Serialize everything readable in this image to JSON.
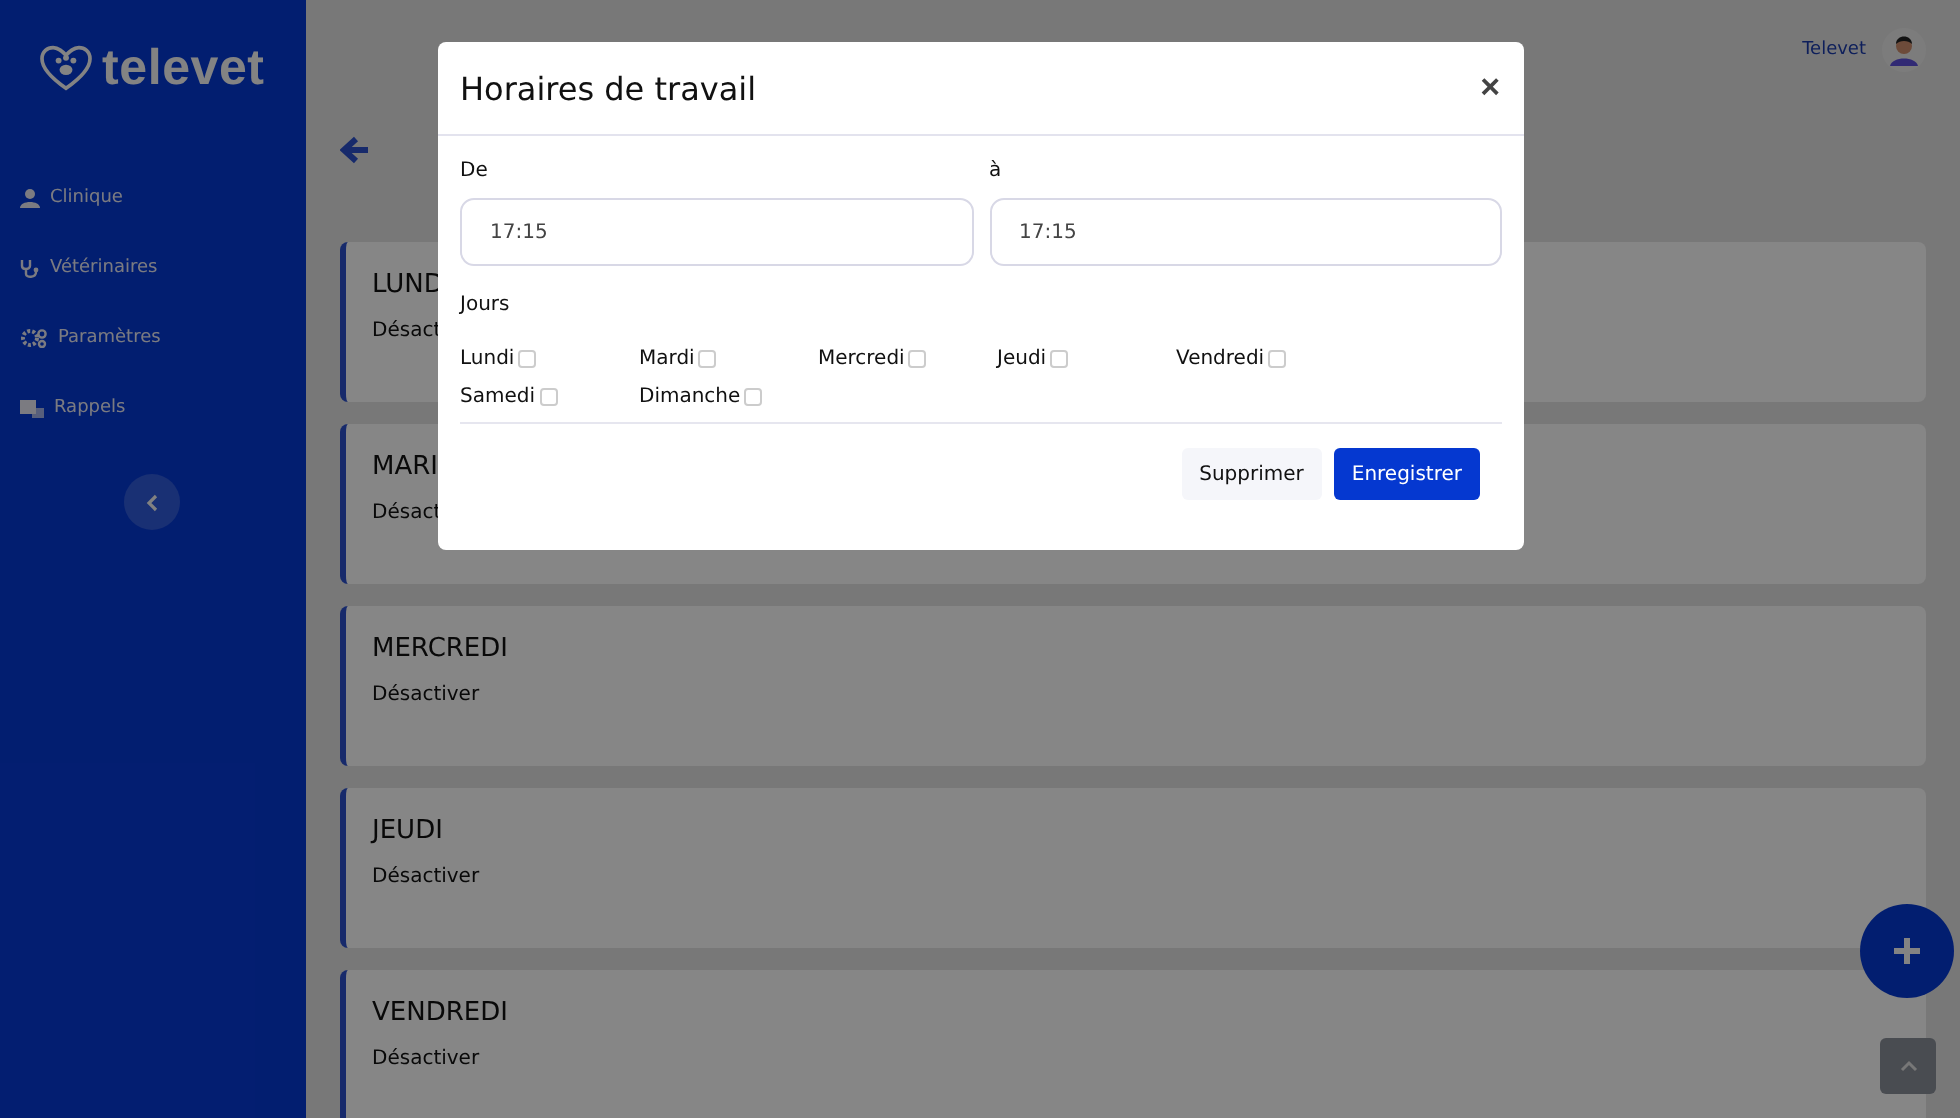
{
  "sidebar": {
    "logo": "televet",
    "items": [
      {
        "label": "Clinique",
        "kind": "person"
      },
      {
        "label": "Vétérinaires",
        "kind": "stethoscope"
      },
      {
        "label": "Paramètres",
        "kind": "gears"
      },
      {
        "label": "Rappels",
        "kind": "reminders"
      }
    ]
  },
  "header": {
    "user": "Televet"
  },
  "cards": [
    {
      "title": "LUND",
      "action": "Désact"
    },
    {
      "title": "MARI",
      "action": "Désact"
    },
    {
      "title": "MERCREDI",
      "action": "Désactiver"
    },
    {
      "title": "JEUDI",
      "action": "Désactiver"
    },
    {
      "title": "VENDREDI",
      "action": "Désactiver"
    }
  ],
  "modal": {
    "title": "Horaires de travail",
    "close": "×",
    "from_label": "De",
    "from_value": "17:15",
    "to_label": "à",
    "to_value": "17:15",
    "days_label": "Jours",
    "days": [
      {
        "label": "Lundi",
        "checked": false
      },
      {
        "label": "Mardi",
        "checked": false
      },
      {
        "label": "Mercredi",
        "checked": false
      },
      {
        "label": "Jeudi",
        "checked": false
      },
      {
        "label": "Vendredi",
        "checked": false
      },
      {
        "label": "Samedi",
        "checked": false
      },
      {
        "label": "Dimanche",
        "checked": false
      }
    ],
    "buttons": [
      {
        "label": "Supprimer",
        "kind": "secondary"
      },
      {
        "label": "Enregistrer",
        "kind": "primary"
      }
    ]
  }
}
